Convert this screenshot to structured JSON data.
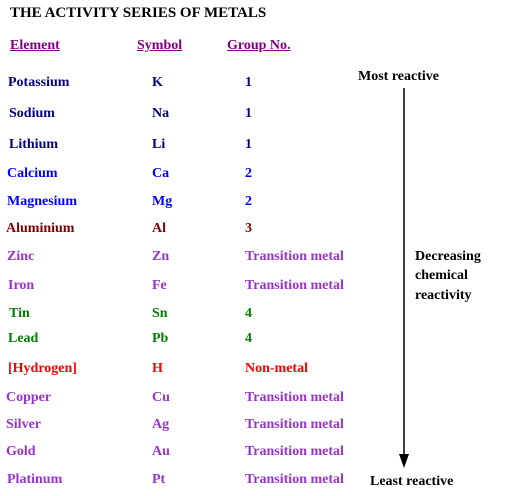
{
  "title": "THE ACTIVITY SERIES OF METALS",
  "headers": {
    "element": "Element",
    "symbol": "Symbol",
    "group": "Group No."
  },
  "side_labels": {
    "most": "Most reactive",
    "decreasing_1": "Decreasing",
    "decreasing_2": "chemical",
    "decreasing_3": "reactivity",
    "least": "Least reactive"
  },
  "colors": {
    "navy": "#000080",
    "blue": "#0000ff",
    "maroon": "#800000",
    "purple": "#9933cc",
    "green": "#008000",
    "red": "#ff0000"
  },
  "rows": [
    {
      "element": "Potassium",
      "symbol": "K",
      "group": "1",
      "color": "#000080"
    },
    {
      "element": "Sodium",
      "symbol": "Na",
      "group": "1",
      "color": "#000080"
    },
    {
      "element": "Lithium",
      "symbol": "Li",
      "group": "1",
      "color": "#000080"
    },
    {
      "element": "Calcium",
      "symbol": "Ca",
      "group": "2",
      "color": "#0000ff"
    },
    {
      "element": "Magnesium",
      "symbol": "Mg",
      "group": "2",
      "color": "#0000ff"
    },
    {
      "element": "Aluminium",
      "symbol": "Al",
      "group": "3",
      "color": "#800000"
    },
    {
      "element": "Zinc",
      "symbol": "Zn",
      "group": "Transition metal",
      "color": "#9933cc"
    },
    {
      "element": "Iron",
      "symbol": "Fe",
      "group": "Transition metal",
      "color": "#9933cc"
    },
    {
      "element": "Tin",
      "symbol": "Sn",
      "group": "4",
      "color": "#008000"
    },
    {
      "element": "Lead",
      "symbol": "Pb",
      "group": "4",
      "color": "#008000"
    },
    {
      "element": "[Hydrogen]",
      "symbol": "H",
      "group": "Non-metal",
      "color": "#ff0000"
    },
    {
      "element": "Copper",
      "symbol": "Cu",
      "group": "Transition metal",
      "color": "#9933cc"
    },
    {
      "element": "Silver",
      "symbol": "Ag",
      "group": "Transition metal",
      "color": "#9933cc"
    },
    {
      "element": "Gold",
      "symbol": "Au",
      "group": "Transition metal",
      "color": "#9933cc"
    },
    {
      "element": "Platinum",
      "symbol": "Pt",
      "group": "Transition metal",
      "color": "#9933cc"
    }
  ]
}
